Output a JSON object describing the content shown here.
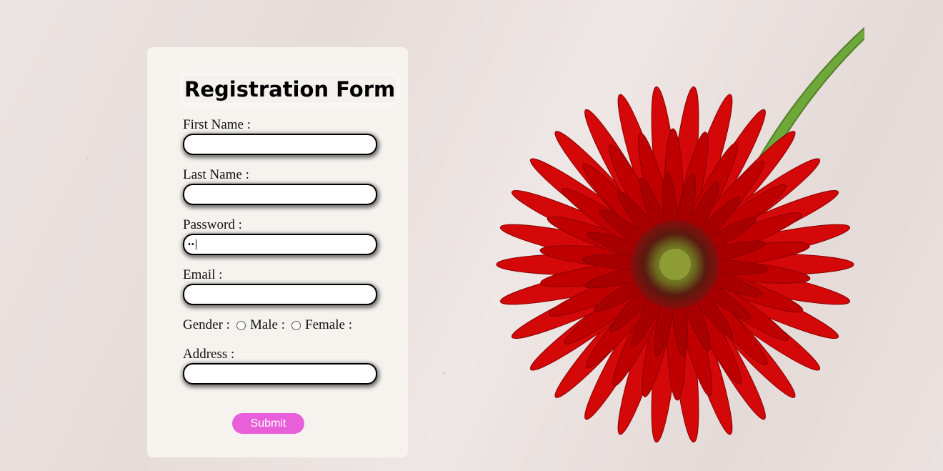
{
  "form": {
    "title": "Registration Form",
    "fields": {
      "first_name": {
        "label": "First Name :",
        "value": ""
      },
      "last_name": {
        "label": "Last Name :",
        "value": ""
      },
      "password": {
        "label": "Password :",
        "value": "••"
      },
      "email": {
        "label": "Email :",
        "value": ""
      },
      "address": {
        "label": "Address :",
        "value": ""
      }
    },
    "gender": {
      "label": "Gender :",
      "options": [
        "Male :",
        "Female :"
      ]
    },
    "submit_label": "Submit"
  },
  "colors": {
    "card_background": "#f6f3ef",
    "submit_button": "#e85fd9",
    "flower_petal": "#c80000",
    "flower_stem": "#6fa83a"
  },
  "icons": {
    "background_image": "red-gerbera-flower"
  }
}
